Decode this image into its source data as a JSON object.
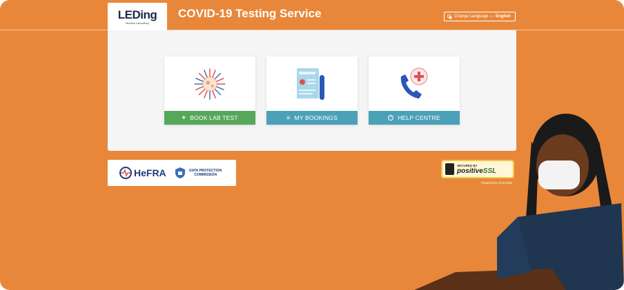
{
  "header": {
    "logo_text": "LEDing",
    "logo_subtext": "Medical Laboratory",
    "title": "COVID-19 Testing Service",
    "language_label": "Change Language —",
    "language_value": "English"
  },
  "cards": [
    {
      "label": "BOOK LAB TEST",
      "icon": "virus-icon",
      "button_icon": "plus-icon",
      "color": "#55a75a"
    },
    {
      "label": "MY BOOKINGS",
      "icon": "test-report-icon",
      "button_icon": "list-icon",
      "color": "#4aa1b8"
    },
    {
      "label": "HELP CENTRE",
      "icon": "phone-medical-icon",
      "button_icon": "question-circle-icon",
      "color": "#4aa1b8"
    }
  ],
  "partners": {
    "hefra": "HeFRA",
    "dpc": "DATA PROTECTION COMMISSION"
  },
  "ssl": {
    "secured_by": "SECURED BY",
    "brand_a": "positive",
    "brand_b": "SSL",
    "powered": "Powered by COLOSIS"
  },
  "colors": {
    "background": "#E8873A",
    "green": "#55a75a",
    "teal": "#4aa1b8"
  }
}
